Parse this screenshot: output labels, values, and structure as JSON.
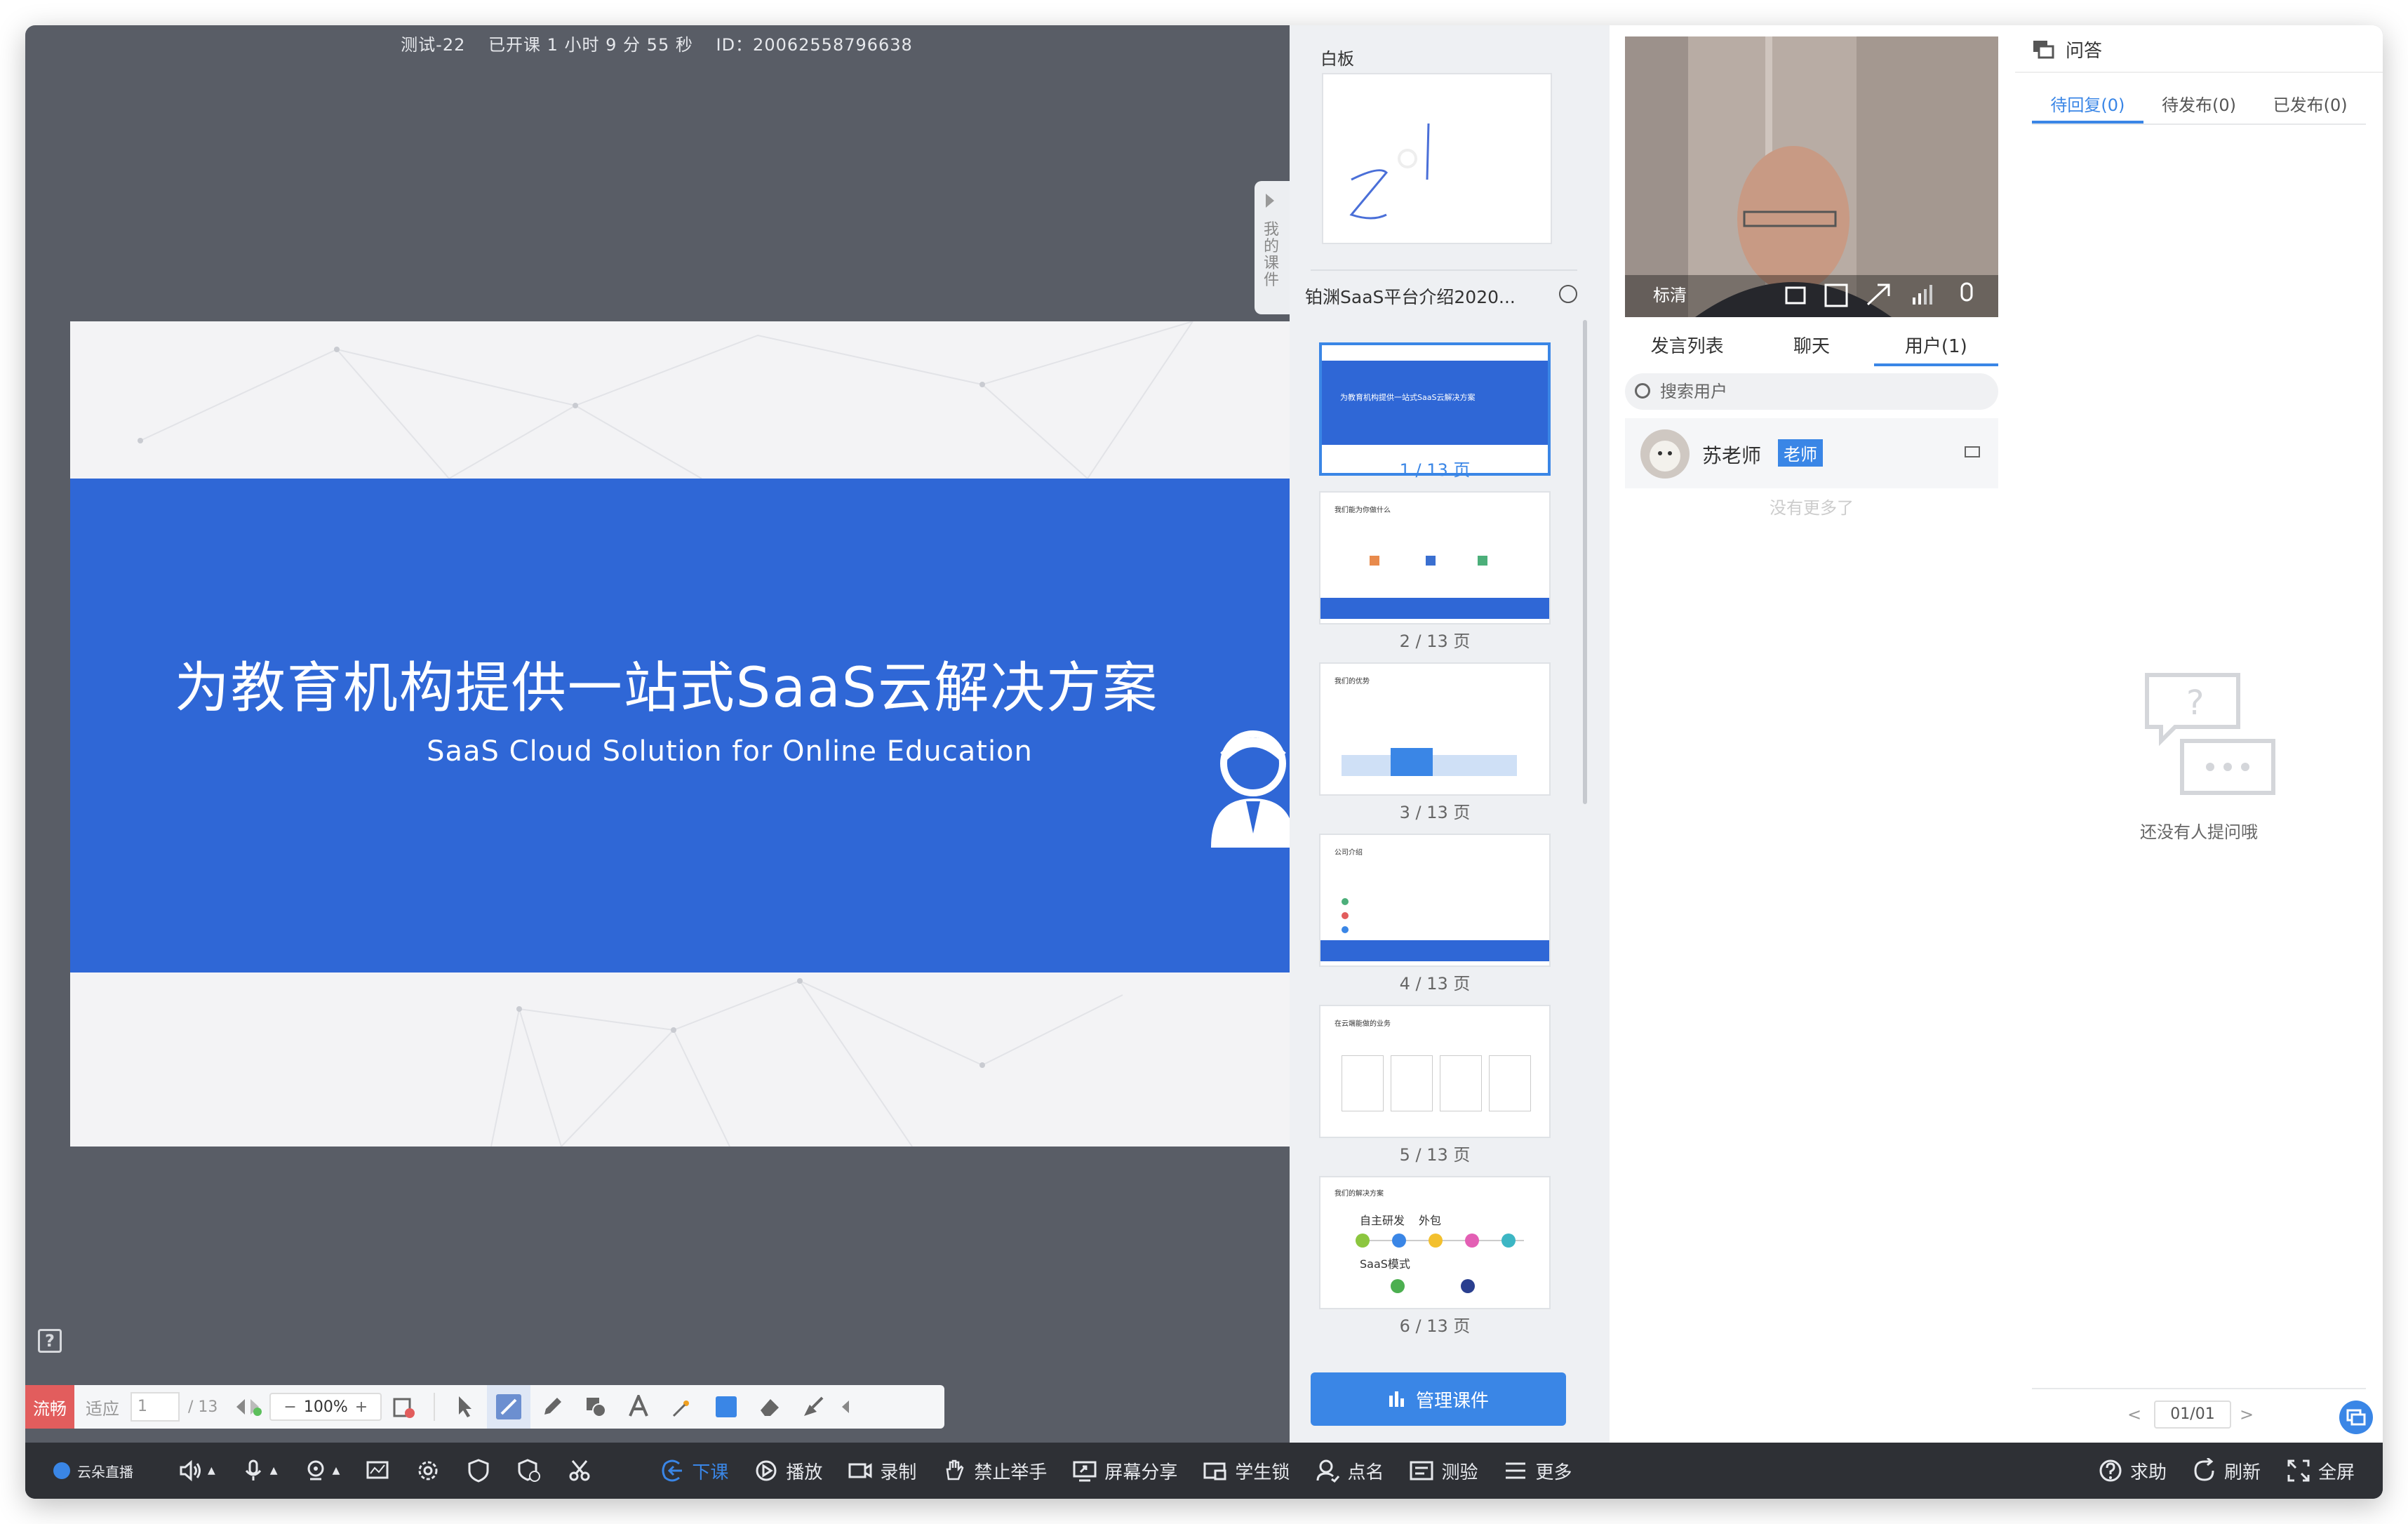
{
  "session": {
    "name": "测试-22",
    "elapsed": "已开课 1 小时 9 分 55 秒",
    "id": "ID：20062558796638"
  },
  "slide": {
    "title": "为教育机构提供一站式SaaS云解决方案",
    "subtitle": "SaaS Cloud Solution for Online Education",
    "band_color": "#2f67d6"
  },
  "course_tab": {
    "label": "我的课件"
  },
  "toolbar": {
    "network": "流畅",
    "fit": "适应",
    "page": "1",
    "total": "/ 13",
    "zoom": "100%",
    "zoom_minus": "−",
    "zoom_plus": "+"
  },
  "thumbs": {
    "whiteboard_label": "白板",
    "whiteboard_text": "z1",
    "deck_title": "铂渊SaaS平台介绍2020...",
    "pages": [
      {
        "label": "1 / 13 页",
        "title": "为教育机构提供一站式SaaS云解决方案",
        "selected": true
      },
      {
        "label": "2 / 13 页",
        "title": "我们能为你做什么",
        "selected": false
      },
      {
        "label": "3 / 13 页",
        "title": "我们的优势",
        "selected": false
      },
      {
        "label": "4 / 13 页",
        "title": "公司介绍",
        "selected": false
      },
      {
        "label": "5 / 13 页",
        "title": "在云端能做的业务",
        "selected": false
      },
      {
        "label": "6 / 13 页",
        "title": "我们的解决方案",
        "selected": false
      }
    ],
    "thumb6": {
      "line1": "自主研发",
      "line2": "外包",
      "line3": "SaaS模式"
    },
    "manage_label": "管理课件"
  },
  "video": {
    "quality": "标清"
  },
  "users": {
    "tabs": [
      "发言列表",
      "聊天",
      "用户(1)"
    ],
    "active_tab": 2,
    "search_placeholder": "搜索用户",
    "list": [
      {
        "name": "苏老师",
        "role": "老师"
      }
    ],
    "no_more": "没有更多了"
  },
  "qa": {
    "title": "问答",
    "tabs": [
      "待回复(0)",
      "待发布(0)",
      "已发布(0)"
    ],
    "active_tab": 0,
    "empty_text": "还没有人提问哦",
    "page": "01/01",
    "prev": "<",
    "next": ">",
    "accent": "#3a86e6"
  },
  "bottom_bar": {
    "brand": "云朵直播",
    "items": [
      {
        "label": "下课",
        "icon": "exit-icon",
        "active": true
      },
      {
        "label": "播放",
        "icon": "play-icon",
        "active": false
      },
      {
        "label": "录制",
        "icon": "record-icon",
        "active": false
      },
      {
        "label": "禁止举手",
        "icon": "hand-icon",
        "active": false
      },
      {
        "label": "屏幕分享",
        "icon": "screen-share-icon",
        "active": false
      },
      {
        "label": "学生锁",
        "icon": "lock-icon",
        "active": false
      },
      {
        "label": "点名",
        "icon": "rollcall-icon",
        "active": false
      },
      {
        "label": "测验",
        "icon": "quiz-icon",
        "active": false
      },
      {
        "label": "更多",
        "icon": "more-icon",
        "active": false
      }
    ],
    "right": [
      {
        "label": "求助",
        "icon": "help-icon"
      },
      {
        "label": "刷新",
        "icon": "refresh-icon"
      },
      {
        "label": "全屏",
        "icon": "fullscreen-icon"
      }
    ]
  }
}
